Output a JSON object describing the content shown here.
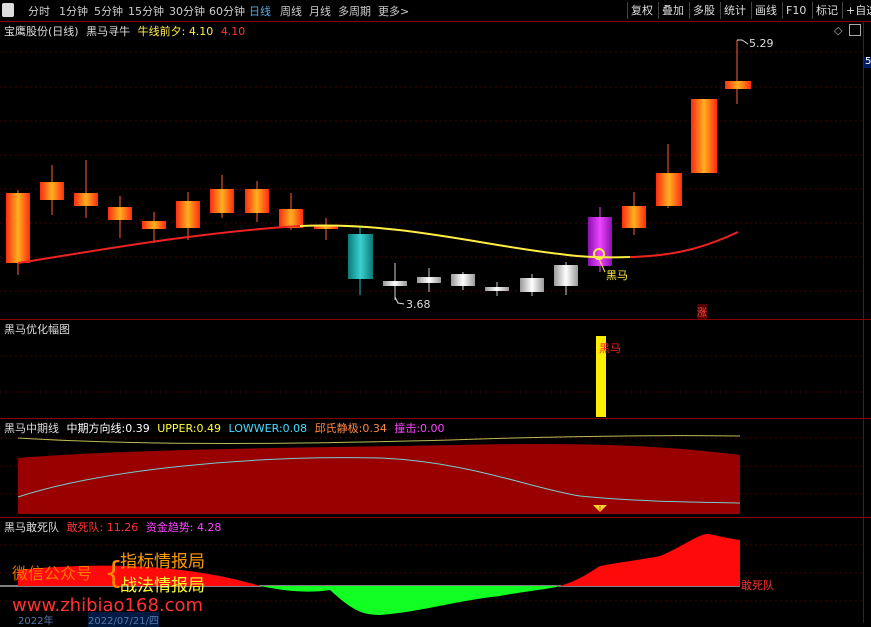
{
  "toolbar": {
    "tabs": [
      "分时",
      "1分钟",
      "5分钟",
      "15分钟",
      "30分钟",
      "60分钟",
      "日线",
      "周线",
      "月线",
      "多周期",
      "更多>"
    ],
    "active": "日线",
    "right_buttons": [
      "复权",
      "叠加",
      "多股",
      "统计",
      "画线",
      "F10",
      "标记",
      "+自选"
    ]
  },
  "main_pane": {
    "stock": "宝鹰股份(日线)",
    "indicator": "黑马寻牛",
    "ma_label": "牛线前夕:",
    "ma_value1": "4.10",
    "ma_value2": "4.10",
    "high_label": "5.29",
    "low_label": "3.68",
    "signal_label": "黑马",
    "zhang": "涨",
    "right_mark": "5"
  },
  "pane2": {
    "title": "黑马优化幅图",
    "bar_label": "黑马"
  },
  "pane3": {
    "title": "黑马中期线",
    "items": [
      {
        "label": "中期方向线:",
        "value": "0.39",
        "color": "#ffffff"
      },
      {
        "label": "UPPER:",
        "value": "0.49",
        "color": "#ffff44"
      },
      {
        "label": "LOWWER:",
        "value": "0.08",
        "color": "#44ddff"
      },
      {
        "label": "邱氏静极:",
        "value": "0.34",
        "color": "#ff8844"
      },
      {
        "label": "撞击:",
        "value": "0.00",
        "color": "#ff44ff"
      }
    ]
  },
  "pane4": {
    "title": "黑马敢死队",
    "item1_label": "敢死队:",
    "item1_value": "11.26",
    "item2_label": "资金趋势:",
    "item2_value": "4.28",
    "end_label": "敢死队"
  },
  "watermark": {
    "wechat": "微信公众号",
    "line1": "指标情报局",
    "line2": "战法情报局",
    "url": "www.zhibiao168.com"
  },
  "bottom": {
    "date1": "2022年",
    "date2": "2022/07/21/四"
  },
  "colors": {
    "up": "#ff3322",
    "down": "#00cccc",
    "ma_red": "#ee2222",
    "ma_yellow": "#ffee44",
    "signal": "#cc22ee",
    "grid": "#550000",
    "dark_red": "#990000",
    "green": "#22ff22"
  }
}
